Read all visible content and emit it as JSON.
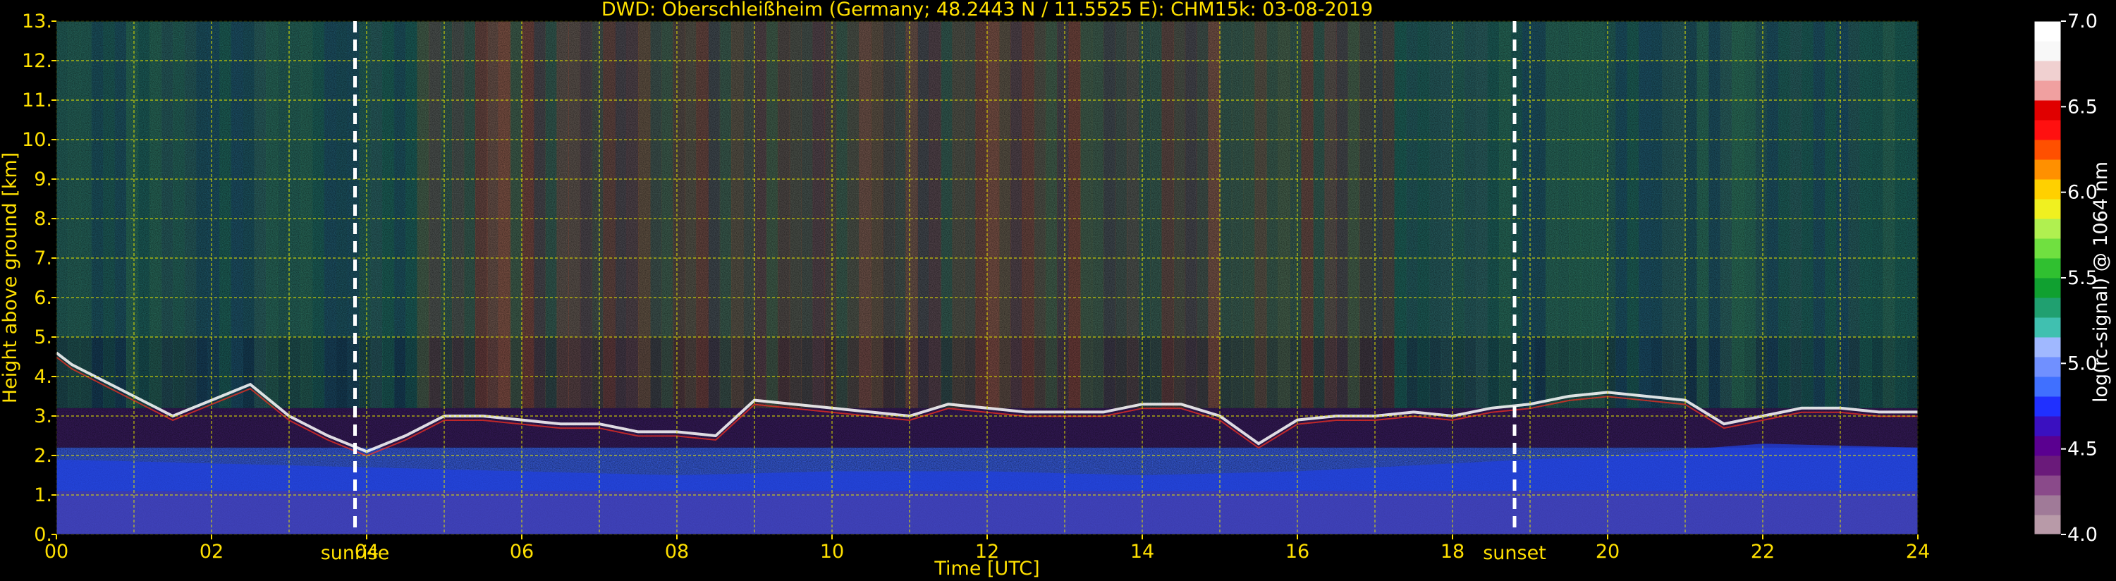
{
  "chart_data": {
    "type": "heatmap",
    "title": "DWD: Oberschleißheim (Germany; 48.2443 N / 11.5525 E):    CHM15k: 03-08-2019",
    "xlabel": "Time [UTC]",
    "ylabel": "Height above ground [km]",
    "xlim": [
      0,
      24
    ],
    "ylim": [
      0,
      13
    ],
    "x_ticks": [
      "00",
      "02",
      "04",
      "06",
      "08",
      "10",
      "12",
      "14",
      "16",
      "18",
      "20",
      "22",
      "24"
    ],
    "x_tick_values": [
      0,
      2,
      4,
      6,
      8,
      10,
      12,
      14,
      16,
      18,
      20,
      22,
      24
    ],
    "y_ticks": [
      "0.",
      "1.",
      "2.",
      "3.",
      "4.",
      "5.",
      "6.",
      "7.",
      "8.",
      "9.",
      "10.",
      "11.",
      "12.",
      "13."
    ],
    "y_tick_values": [
      0,
      1,
      2,
      3,
      4,
      5,
      6,
      7,
      8,
      9,
      10,
      11,
      12,
      13
    ],
    "grid": true,
    "markers": [
      {
        "label": "sunrise",
        "x": 3.85
      },
      {
        "label": "sunset",
        "x": 18.8
      }
    ],
    "colorbar": {
      "label": "log(rc-signal) @ 1064 nm",
      "min": 4.0,
      "max": 7.0,
      "ticks": [
        "4.0",
        "4.5",
        "5.0",
        "5.5",
        "6.0",
        "6.5",
        "7.0"
      ],
      "tick_values": [
        4.0,
        4.5,
        5.0,
        5.5,
        6.0,
        6.5,
        7.0
      ],
      "colors": [
        "#b89aa8",
        "#a07a98",
        "#8a4a8a",
        "#6a1a7a",
        "#5a0090",
        "#3a10c0",
        "#2030ff",
        "#4070ff",
        "#7090ff",
        "#a0b8ff",
        "#40c0b0",
        "#20a070",
        "#10a030",
        "#30c030",
        "#70e040",
        "#b0f050",
        "#f0f020",
        "#ffd000",
        "#ff9000",
        "#ff5000",
        "#ff1010",
        "#e00000",
        "#f0a0a0",
        "#f0d0d0",
        "#f8f8f8",
        "#ffffff"
      ]
    },
    "boundary_layer_top": {
      "x": [
        0.0,
        0.2,
        0.5,
        1.0,
        1.5,
        2.0,
        2.5,
        3.0,
        3.5,
        4.0,
        4.5,
        5.0,
        5.5,
        6.0,
        6.5,
        7.0,
        7.5,
        8.0,
        8.5,
        9.0,
        9.5,
        10.0,
        10.5,
        11.0,
        11.5,
        12.0,
        12.5,
        13.0,
        13.5,
        14.0,
        14.5,
        15.0,
        15.5,
        16.0,
        16.5,
        17.0,
        17.5,
        18.0,
        18.5,
        19.0,
        19.5,
        20.0,
        20.5,
        21.0,
        21.5,
        22.0,
        22.5,
        23.0,
        23.5,
        24.0
      ],
      "y": [
        4.6,
        4.3,
        4.0,
        3.5,
        3.0,
        3.4,
        3.8,
        3.0,
        2.5,
        2.1,
        2.5,
        3.0,
        3.0,
        2.9,
        2.8,
        2.8,
        2.6,
        2.6,
        2.5,
        3.4,
        3.3,
        3.2,
        3.1,
        3.0,
        3.3,
        3.2,
        3.1,
        3.1,
        3.1,
        3.3,
        3.3,
        3.0,
        2.3,
        2.9,
        3.0,
        3.0,
        3.1,
        3.0,
        3.2,
        3.3,
        3.5,
        3.6,
        3.5,
        3.4,
        2.8,
        3.0,
        3.2,
        3.2,
        3.1,
        3.1
      ]
    },
    "aerosol_layer_top": {
      "x": [
        0,
        2,
        4,
        6,
        8,
        10,
        12,
        14,
        16,
        18,
        20,
        22,
        24
      ],
      "y": [
        1.9,
        1.8,
        1.7,
        1.6,
        1.5,
        1.6,
        1.6,
        1.5,
        1.6,
        1.8,
        2.0,
        2.3,
        2.2
      ]
    }
  }
}
